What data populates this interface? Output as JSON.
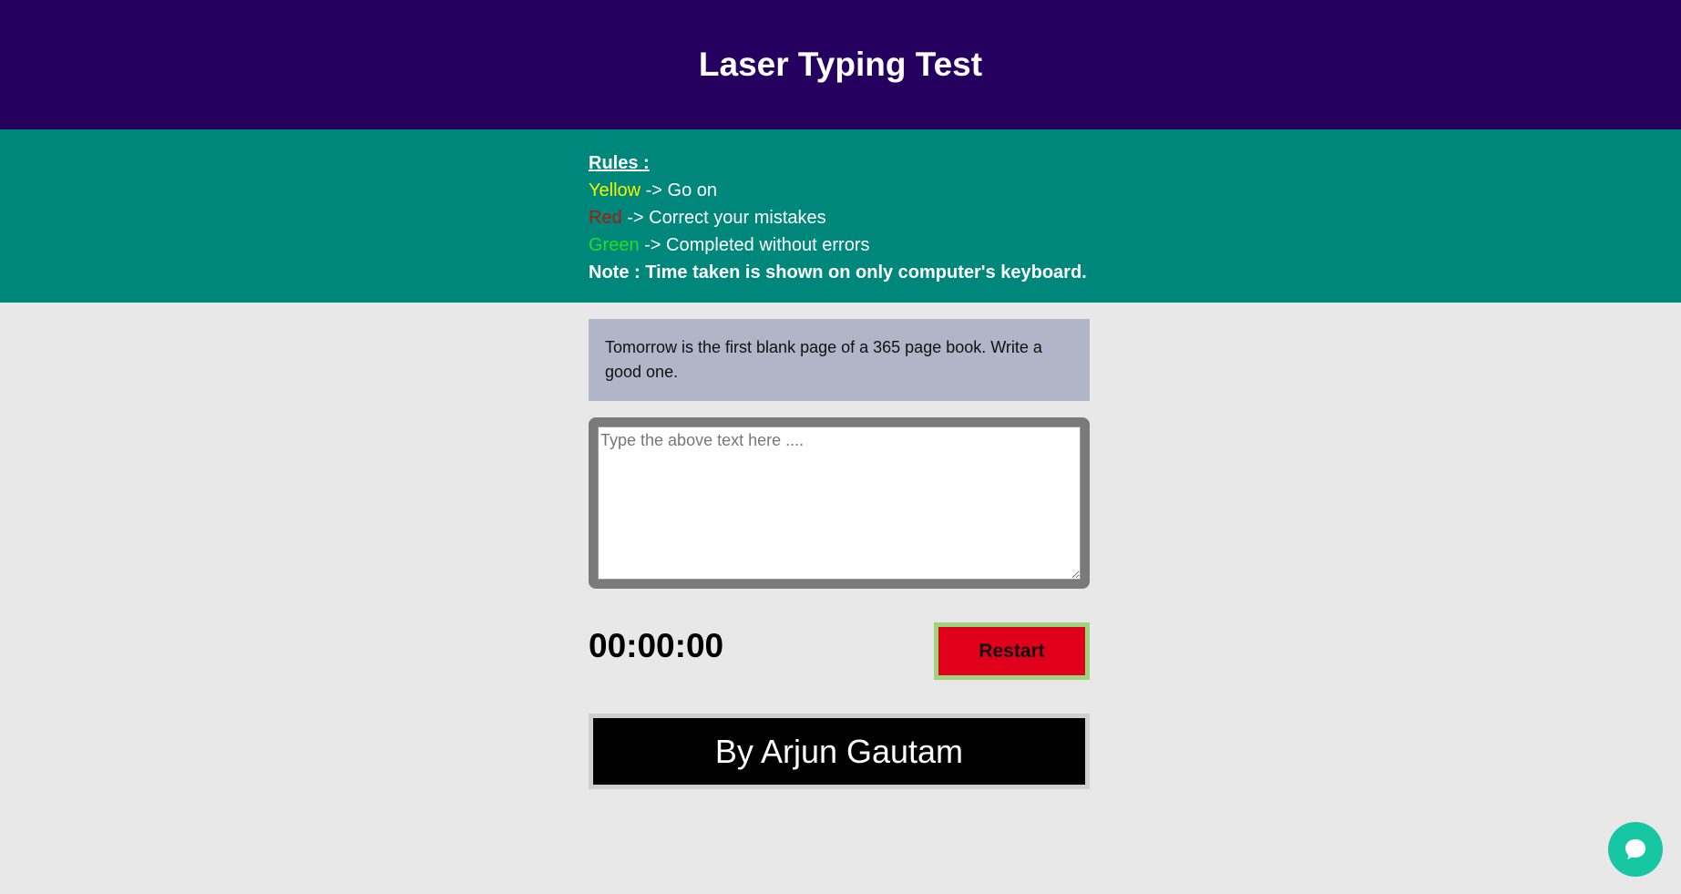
{
  "header": {
    "title": "Laser Typing Test"
  },
  "rules": {
    "title": "Rules :",
    "items": [
      {
        "color_word": "Yellow",
        "description": " -> Go on",
        "color": "#f5f500"
      },
      {
        "color_word": "Red",
        "description": " -> Correct your mistakes",
        "color": "#a81a0c"
      },
      {
        "color_word": "Green",
        "description": " -> Completed without errors",
        "color": "#20e020"
      }
    ],
    "note": "Note : Time taken is shown on only computer's keyboard."
  },
  "passage": {
    "text": "Tomorrow is the first blank page of a 365 page book. Write a good one."
  },
  "input": {
    "placeholder": "Type the above text here ....",
    "value": ""
  },
  "timer": {
    "value": "00:00:00"
  },
  "restart": {
    "label": "Restart"
  },
  "footer": {
    "credit": "By Arjun Gautam"
  },
  "chat": {
    "icon": "chat-bubble-icon"
  },
  "colors": {
    "header_bg": "#25005f",
    "rules_bg": "#00877c",
    "restart_bg": "#e0001c",
    "chat_bg": "#17c6a3"
  }
}
